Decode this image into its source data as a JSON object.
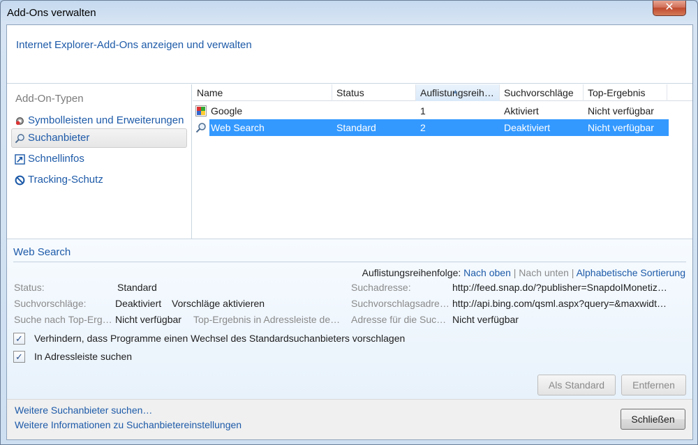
{
  "window": {
    "title": "Add-Ons verwalten",
    "close_glyph": "✕"
  },
  "header": {
    "text": "Internet Explorer-Add-Ons anzeigen und verwalten"
  },
  "sidebar": {
    "title": "Add-On-Typen",
    "items": [
      {
        "label": "Symbolleisten und Erweiterungen",
        "icon": "gear-icon"
      },
      {
        "label": "Suchanbieter",
        "icon": "magnifier-icon"
      },
      {
        "label": "Schnellinfos",
        "icon": "accelerator-icon"
      },
      {
        "label": "Tracking-Schutz",
        "icon": "no-entry-icon"
      }
    ]
  },
  "list": {
    "columns": [
      "Name",
      "Status",
      "Auflistungsreih…",
      "Suchvorschläge",
      "Top-Ergebnis"
    ],
    "rows": [
      {
        "name": "Google",
        "status": "",
        "order": "1",
        "suggestions": "Aktiviert",
        "top": "Nicht verfügbar"
      },
      {
        "name": "Web Search",
        "status": "Standard",
        "order": "2",
        "suggestions": "Deaktiviert",
        "top": "Nicht verfügbar"
      }
    ]
  },
  "details": {
    "title": "Web Search",
    "sort_label": "Auflistungsreihenfolge:",
    "sort_up": "Nach oben",
    "sep1": "|",
    "sort_down": "Nach unten",
    "sep2": "|",
    "sort_alpha": "Alphabetische Sortierung",
    "status_label": "Status:",
    "status_value": "Standard",
    "sugg_label": "Suchvorschläge:",
    "sugg_value": "Deaktiviert",
    "sugg_link": "Vorschläge aktivieren",
    "top_label": "Suche nach Top-Erg…",
    "top_value": "Nicht verfügbar",
    "top_addr_label": "Top-Ergebnis in Adressleiste de…",
    "search_addr_label": "Suchadresse:",
    "search_addr_value": "http://feed.snap.do/?publisher=SnapdoIMonetiz…",
    "sugg_addr_label": "Suchvorschlagsadre…",
    "sugg_addr_value": "http://api.bing.com/qsml.aspx?query=&maxwidt…",
    "addr_for_label": "Adresse für die Suc…",
    "addr_for_value": "Nicht verfügbar",
    "check1": "Verhindern, dass Programme einen Wechsel des Standardsuchanbieters vorschlagen",
    "check2": "In Adressleiste suchen",
    "checkmark": "✓",
    "btn_default": "Als Standard",
    "btn_remove": "Entfernen"
  },
  "footer": {
    "link1": "Weitere Suchanbieter suchen…",
    "link2": "Weitere Informationen zu Suchanbietereinstellungen",
    "close_btn": "Schließen"
  }
}
